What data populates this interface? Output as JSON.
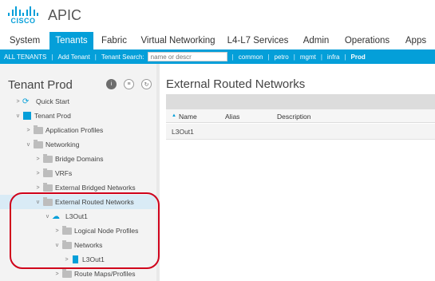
{
  "header": {
    "logo_text": "CISCO",
    "app_name": "APIC"
  },
  "tabs": [
    {
      "label": "System",
      "active": false
    },
    {
      "label": "Tenants",
      "active": true
    },
    {
      "label": "Fabric",
      "active": false
    },
    {
      "label": "Virtual Networking",
      "active": false
    },
    {
      "label": "L4-L7 Services",
      "active": false
    },
    {
      "label": "Admin",
      "active": false
    },
    {
      "label": "Operations",
      "active": false
    },
    {
      "label": "Apps",
      "active": false
    }
  ],
  "subnav": {
    "all_tenants": "ALL TENANTS",
    "add_tenant": "Add Tenant",
    "search_label": "Tenant Search:",
    "search_placeholder": "name or descr",
    "tenants": [
      "common",
      "petro",
      "mgmt",
      "infra",
      "Prod"
    ],
    "current": "Prod"
  },
  "left": {
    "title": "Tenant Prod",
    "tree": [
      {
        "label": "Quick Start",
        "icon": "quick-start-icon",
        "expanded": false
      },
      {
        "label": "Tenant Prod",
        "icon": "tenant-icon",
        "expanded": true
      },
      {
        "label": "Application Profiles",
        "icon": "folder-icon",
        "expanded": false
      },
      {
        "label": "Networking",
        "icon": "folder-icon",
        "expanded": true
      },
      {
        "label": "Bridge Domains",
        "icon": "folder-icon",
        "expanded": false
      },
      {
        "label": "VRFs",
        "icon": "folder-icon",
        "expanded": false
      },
      {
        "label": "External Bridged Networks",
        "icon": "folder-icon",
        "expanded": false
      },
      {
        "label": "External Routed Networks",
        "icon": "folder-icon",
        "expanded": true,
        "selected": true
      },
      {
        "label": "L3Out1",
        "icon": "cloud-icon",
        "expanded": true
      },
      {
        "label": "Logical Node Profiles",
        "icon": "folder-icon",
        "expanded": false
      },
      {
        "label": "Networks",
        "icon": "folder-icon",
        "expanded": true
      },
      {
        "label": "L3Out1",
        "icon": "document-icon",
        "expanded": false
      },
      {
        "label": "Route Maps/Profiles",
        "icon": "folder-icon",
        "expanded": false
      }
    ]
  },
  "right": {
    "title": "External Routed Networks",
    "columns": [
      "Name",
      "Alias",
      "Description"
    ],
    "rows": [
      {
        "name": "L3Out1",
        "alias": "",
        "description": ""
      }
    ]
  },
  "colors": {
    "brand": "#049fd9",
    "highlight": "#d0021b"
  }
}
